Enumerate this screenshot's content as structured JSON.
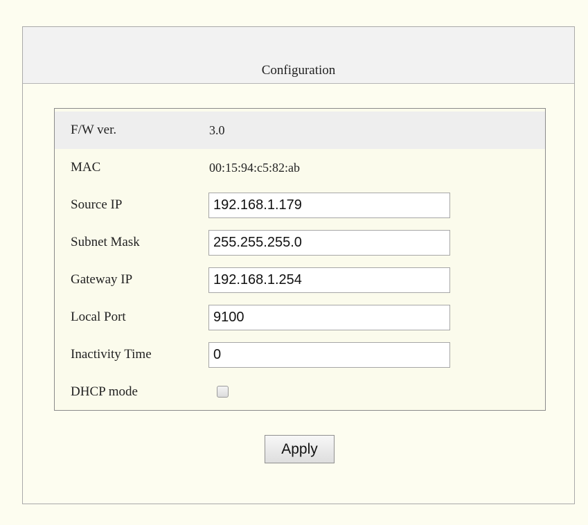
{
  "page": {
    "title": "Configuration"
  },
  "config": {
    "fw_label": "F/W ver.",
    "fw_value": "3.0",
    "mac_label": "MAC",
    "mac_value": "00:15:94:c5:82:ab",
    "source_ip_label": "Source IP",
    "source_ip_value": "192.168.1.179",
    "subnet_mask_label": "Subnet Mask",
    "subnet_mask_value": "255.255.255.0",
    "gateway_ip_label": "Gateway IP",
    "gateway_ip_value": "192.168.1.254",
    "local_port_label": "Local Port",
    "local_port_value": "9100",
    "inactivity_time_label": "Inactivity Time",
    "inactivity_time_value": "0",
    "dhcp_mode_label": "DHCP mode",
    "dhcp_mode_checked": false
  },
  "actions": {
    "apply_label": "Apply"
  }
}
